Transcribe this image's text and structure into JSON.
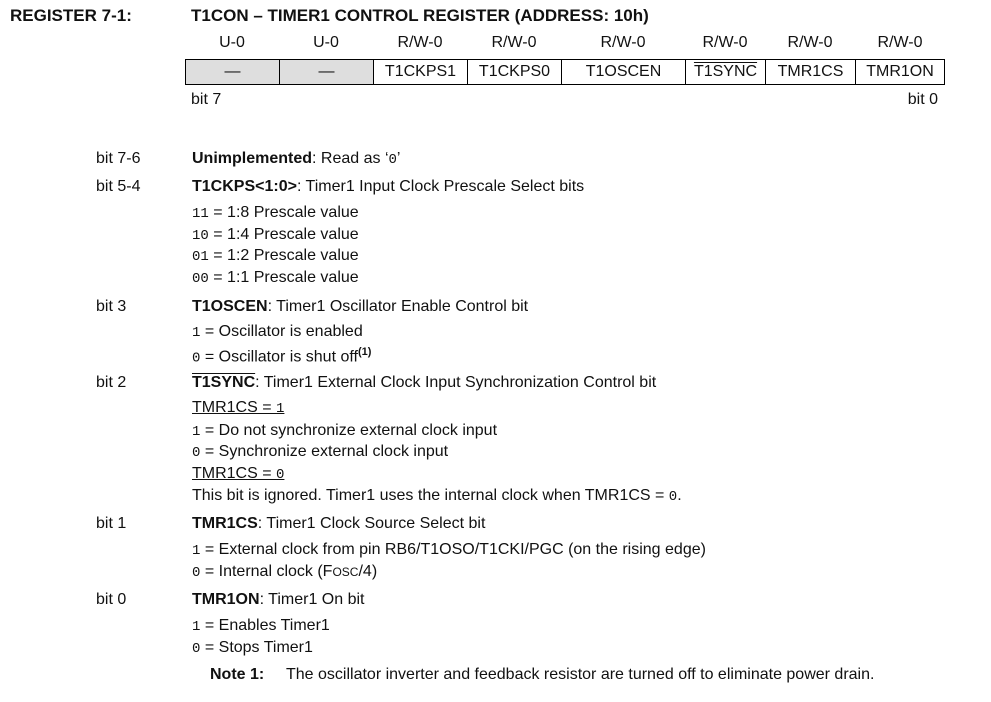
{
  "title": {
    "label": "REGISTER 7-1:",
    "text": "T1CON – TIMER1 CONTROL REGISTER (ADDRESS: 10h)"
  },
  "register": {
    "access": [
      "U-0",
      "U-0",
      "R/W-0",
      "R/W-0",
      "R/W-0",
      "R/W-0",
      "R/W-0",
      "R/W-0"
    ],
    "bits": [
      "—",
      "—",
      "T1CKPS1",
      "T1CKPS0",
      "T1OSCEN",
      "T1SYNC",
      "TMR1CS",
      "TMR1ON"
    ],
    "msb_label": "bit 7",
    "lsb_label": "bit 0"
  },
  "descriptions": {
    "b76": {
      "bit": "bit 7-6",
      "name": "Unimplemented",
      "text": ": Read as ‘",
      "val": "0",
      "end": "’"
    },
    "b54": {
      "bit": "bit 5-4",
      "name": "T1CKPS<1:0>",
      "text": ": Timer1 Input Clock Prescale Select bits",
      "items": [
        {
          "code": "11",
          "text": " = 1:8 Prescale value"
        },
        {
          "code": "10",
          "text": " = 1:4 Prescale value"
        },
        {
          "code": "01",
          "text": " = 1:2 Prescale value"
        },
        {
          "code": "00",
          "text": " = 1:1 Prescale value"
        }
      ]
    },
    "b3": {
      "bit": "bit 3",
      "name": "T1OSCEN",
      "text": ": Timer1 Oscillator Enable Control bit",
      "items": [
        {
          "code": "1",
          "text": " = Oscillator is enabled",
          "sup": ""
        },
        {
          "code": "0",
          "text": " = Oscillator is shut off",
          "sup": "(1)"
        }
      ]
    },
    "b2": {
      "bit": "bit 2",
      "name": "T1SYNC",
      "text": ": Timer1 External Clock Input Synchronization Control bit",
      "cond1": {
        "text": "TMR1CS = ",
        "code": "1"
      },
      "items1": [
        {
          "code": "1",
          "text": " = Do not synchronize external clock input"
        },
        {
          "code": "0",
          "text": " = Synchronize external clock input"
        }
      ],
      "cond0": {
        "text": "TMR1CS = ",
        "code": "0"
      },
      "ignored": {
        "text": "This bit is ignored. Timer1 uses the internal clock when TMR1CS = ",
        "code": "0",
        "end": "."
      }
    },
    "b1": {
      "bit": "bit 1",
      "name": "TMR1CS",
      "text": ": Timer1 Clock Source Select bit",
      "items": [
        {
          "code": "1",
          "text": " = External clock from pin RB6/T1OSO/T1CKI/PGC (on the rising edge)"
        },
        {
          "code": "0",
          "text": " = Internal clock (F",
          "sc": "OSC",
          "end": "/4)"
        }
      ]
    },
    "b0": {
      "bit": "bit 0",
      "name": "TMR1ON",
      "text": ": Timer1 On bit",
      "items": [
        {
          "code": "1",
          "text": " = Enables Timer1"
        },
        {
          "code": "0",
          "text": " = Stops Timer1"
        }
      ]
    }
  },
  "note": {
    "label": "Note 1:",
    "text": "The oscillator inverter and feedback resistor are turned off to eliminate power drain."
  }
}
